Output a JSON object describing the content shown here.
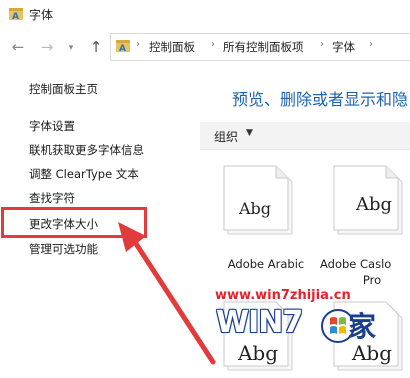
{
  "window": {
    "title": "字体"
  },
  "nav": {
    "breadcrumbs": [
      "控制面板",
      "所有控制面板项",
      "字体"
    ]
  },
  "sidebar": {
    "items": [
      {
        "label": "控制面板主页"
      },
      {
        "label": "字体设置"
      },
      {
        "label": "联机获取更多字体信息"
      },
      {
        "label": "调整 ClearType 文本"
      },
      {
        "label": "查找字符"
      },
      {
        "label": "更改字体大小"
      },
      {
        "label": "管理可选功能"
      }
    ]
  },
  "main": {
    "heading": "预览、删除或者显示和隐",
    "toolbar": {
      "organize_label": "组织"
    },
    "fonts": [
      {
        "name": "Adobe Arabic",
        "sample": "Abg"
      },
      {
        "name": "Adobe Caslo",
        "name_line2": "Pro",
        "sample": "Abg"
      },
      {
        "name": "",
        "sample": "Abg"
      },
      {
        "name": "",
        "sample": "Abg"
      }
    ]
  },
  "watermark": {
    "url": "www.win7zhijia.cn",
    "logo_text": "WIN7",
    "logo_suffix": "家"
  },
  "colors": {
    "link_heading": "#1e62b0",
    "highlight": "#e23b3b",
    "watermark_red": "#e0242b",
    "watermark_blue": "#1b3f8f"
  }
}
